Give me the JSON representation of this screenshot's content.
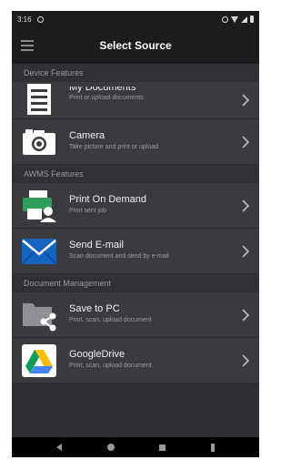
{
  "status_bar": {
    "time": "3:16"
  },
  "app_bar": {
    "title": "Select Source",
    "menu_icon": "hamburger-menu-icon"
  },
  "sections": [
    {
      "header": "Device Features",
      "items": [
        {
          "title": "My Documents",
          "subtitle": "Print or upload documents",
          "icon": "document-icon"
        },
        {
          "title": "Camera",
          "subtitle": "Take picture and print or upload",
          "icon": "camera-icon"
        }
      ]
    },
    {
      "header": "AWMS Features",
      "items": [
        {
          "title": "Print On Demand",
          "subtitle": "Print sent job",
          "icon": "print-on-demand-icon"
        },
        {
          "title": "Send E-mail",
          "subtitle": "Scan document and send by e-mail",
          "icon": "email-icon"
        }
      ]
    },
    {
      "header": "Document Management",
      "items": [
        {
          "title": "Save to PC",
          "subtitle": "Print, scan, upload document",
          "icon": "folder-share-icon"
        },
        {
          "title": "GoogleDrive",
          "subtitle": "Print, scan, upload document",
          "icon": "google-drive-icon"
        }
      ]
    }
  ],
  "nav_bar": {
    "icons": [
      "back-icon",
      "home-icon",
      "recent-apps-icon",
      "accessibility-icon"
    ]
  },
  "colors": {
    "background": "#2f2f33",
    "item_background": "#3a3a3f",
    "bar_background": "#1c1c1e",
    "email_blue": "#1565c0",
    "printer_green": "#2e9d57"
  }
}
